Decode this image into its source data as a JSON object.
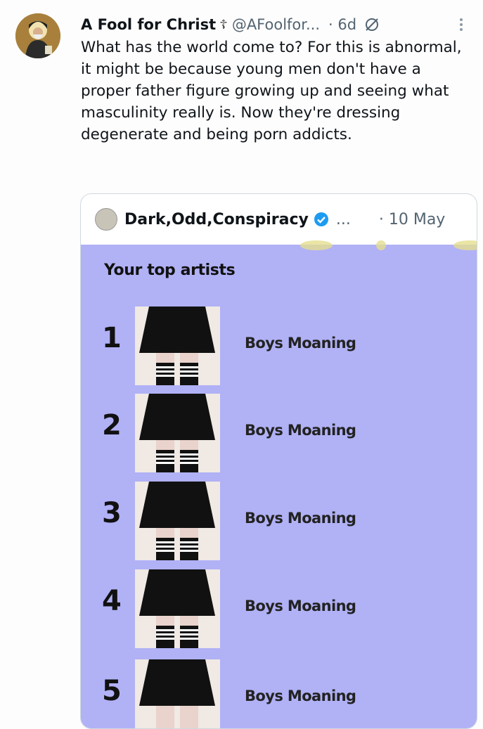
{
  "post": {
    "display_name": "A Fool for Christ",
    "name_glyph": "☦",
    "handle": "@AFoolfor...",
    "time": "· 6d",
    "body": "What has the world come to? For this is abnormal, it might be because young men don't have a proper father figure growing up and seeing what masculinity really is. Now they're dressing degenerate and being porn addicts."
  },
  "quoted": {
    "display_name": "Dark,Odd,Conspiracy",
    "overflow": "...",
    "time": "· 10 May",
    "card_title": "Your top artists",
    "artists": [
      {
        "rank": "1",
        "name": "Boys Moaning"
      },
      {
        "rank": "2",
        "name": "Boys Moaning"
      },
      {
        "rank": "3",
        "name": "Boys Moaning"
      },
      {
        "rank": "4",
        "name": "Boys Moaning"
      },
      {
        "rank": "5",
        "name": "Boys Moaning"
      }
    ]
  },
  "colors": {
    "card_bg": "#b1b1f6",
    "verified": "#1d9bf0",
    "muted_text": "#536471"
  }
}
